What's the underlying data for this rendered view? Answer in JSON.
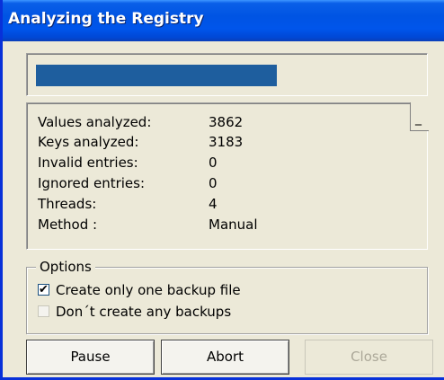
{
  "window": {
    "title": "Analyzing the Registry"
  },
  "progress": {
    "fraction": 0.64,
    "color": "#1e5e9e"
  },
  "stats": [
    {
      "label": "Values analyzed:",
      "value": "3862"
    },
    {
      "label": "Keys analyzed:",
      "value": "3183"
    },
    {
      "label": "Invalid entries:",
      "value": "0"
    },
    {
      "label": "Ignored entries:",
      "value": "0"
    },
    {
      "label": "Threads:",
      "value": "4"
    },
    {
      "label": "Method :",
      "value": "Manual"
    }
  ],
  "collapse_button": {
    "label": "_",
    "icon": "minimize-icon"
  },
  "options": {
    "legend": "Options",
    "items": [
      {
        "label": "Create only one backup file",
        "checked": true,
        "enabled": true
      },
      {
        "label": "Don´t create any backups",
        "checked": false,
        "enabled": false
      }
    ]
  },
  "buttons": {
    "pause": "Pause",
    "abort": "Abort",
    "close": "Close"
  },
  "colors": {
    "titlebar": "#0054e3",
    "window_border": "#0831d9",
    "dialog_bg": "#ece9d8"
  }
}
